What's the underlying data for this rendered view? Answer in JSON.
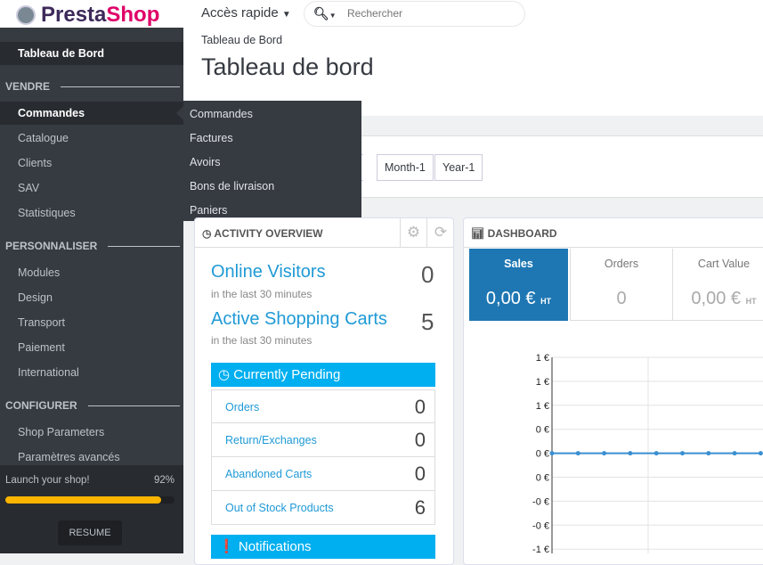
{
  "topbar": {
    "logo": "PrestaShop",
    "logo_a": "Presta",
    "logo_b": "Shop",
    "quick_access": "Accès rapide",
    "search_placeholder": "Rechercher"
  },
  "sidebar": {
    "dashboard": "Tableau de Bord",
    "sections": [
      {
        "title": "VENDRE",
        "items": [
          "Commandes",
          "Catalogue",
          "Clients",
          "SAV",
          "Statistiques"
        ]
      },
      {
        "title": "PERSONNALISER",
        "items": [
          "Modules",
          "Design",
          "Transport",
          "Paiement",
          "International"
        ]
      },
      {
        "title": "CONFIGURER",
        "items": [
          "Shop Parameters",
          "Paramètres avancés"
        ]
      }
    ],
    "launch": {
      "label": "Launch your shop!",
      "percent_label": "92%",
      "progress": 0.92,
      "resume": "RESUME"
    }
  },
  "submenu": [
    "Commandes",
    "Factures",
    "Avoirs",
    "Bons de livraison",
    "Paniers"
  ],
  "header": {
    "breadcrumb": "Tableau de Bord",
    "title": "Tableau de bord"
  },
  "filters": {
    "partial": "-1",
    "month": "Month-1",
    "year": "Year-1"
  },
  "activity": {
    "title": "ACTIVITY OVERVIEW",
    "visitors_label": "Online Visitors",
    "visitors": "0",
    "visitors_sub": "in the last 30 minutes",
    "carts_label": "Active Shopping Carts",
    "carts": "5",
    "carts_sub": "in the last 30 minutes",
    "pending_title": "Currently Pending",
    "pending": [
      {
        "label": "Orders",
        "value": "0"
      },
      {
        "label": "Return/Exchanges",
        "value": "0"
      },
      {
        "label": "Abandoned Carts",
        "value": "0"
      },
      {
        "label": "Out of Stock Products",
        "value": "6"
      }
    ],
    "notifications_title": "Notifications"
  },
  "dashboard": {
    "title": "DASHBOARD",
    "kpis": [
      {
        "label": "Sales",
        "value": "0,00 €",
        "unit": "HT"
      },
      {
        "label": "Orders",
        "value": "0",
        "unit": ""
      },
      {
        "label": "Cart Value",
        "value": "0,00 €",
        "unit": "HT"
      }
    ],
    "accent": "#1e77b3"
  },
  "chart_data": {
    "type": "line",
    "ytick_labels": [
      "1 €",
      "1 €",
      "1 €",
      "0 €",
      "0 €",
      "0 €",
      "-0 €",
      "-0 €",
      "-1 €"
    ],
    "ylim": [
      -1,
      1
    ],
    "grid": true,
    "series": [
      {
        "values": [
          0,
          0,
          0,
          0,
          0,
          0,
          0,
          0,
          0
        ],
        "color": "#3a8fd0"
      }
    ]
  }
}
